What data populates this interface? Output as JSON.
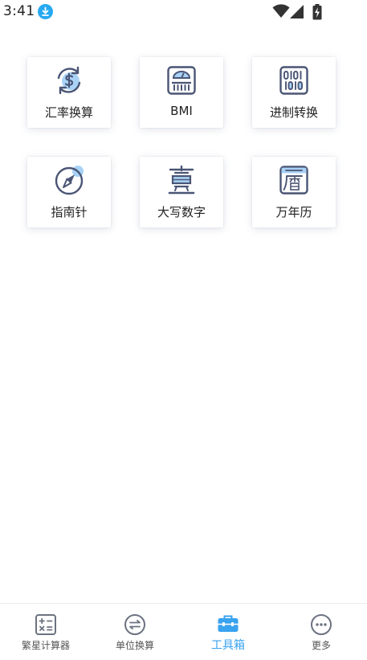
{
  "status_bar": {
    "time": "3:41",
    "icons": [
      "download-icon",
      "wifi-icon",
      "signal-icon",
      "battery-charging-icon"
    ]
  },
  "tools": [
    {
      "label": "汇率换算",
      "icon": "currency-exchange-icon"
    },
    {
      "label": "BMI",
      "icon": "scale-icon"
    },
    {
      "label": "进制转换",
      "icon": "binary-icon"
    },
    {
      "label": "指南针",
      "icon": "compass-icon"
    },
    {
      "label": "大写数字",
      "icon": "chinese-numeral-icon"
    },
    {
      "label": "万年历",
      "icon": "calendar-icon"
    }
  ],
  "bottom_nav": {
    "items": [
      {
        "label": "繁星计算器",
        "icon": "calculator-icon"
      },
      {
        "label": "单位换算",
        "icon": "swap-icon"
      },
      {
        "label": "工具箱",
        "icon": "toolbox-icon"
      },
      {
        "label": "更多",
        "icon": "more-icon"
      }
    ],
    "active_index": 2
  },
  "colors": {
    "accent": "#3aa3f0",
    "icon_stroke": "#4a5575",
    "icon_fill": "#a9d2f7",
    "download_badge": "#26a9f2"
  }
}
